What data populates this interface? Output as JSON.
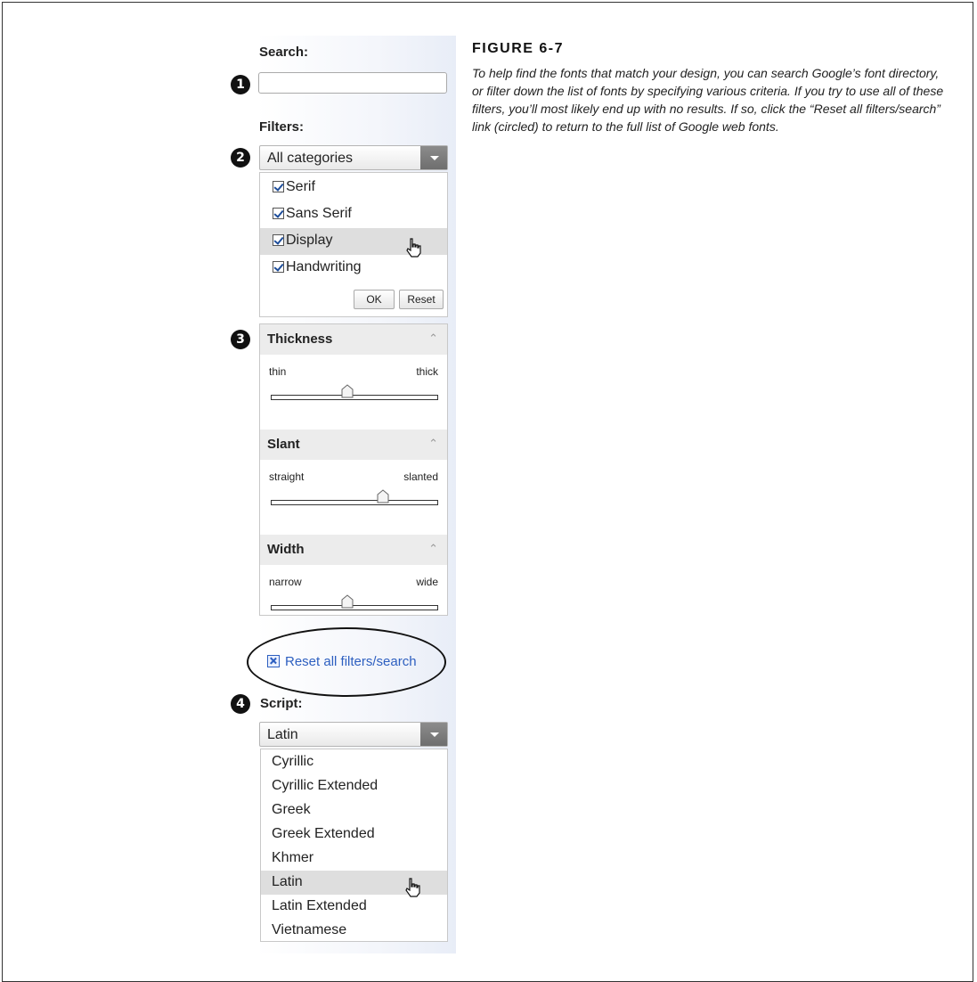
{
  "labels": {
    "search": "Search:",
    "filters": "Filters:",
    "script": "Script:"
  },
  "search": {
    "value": ""
  },
  "badges": [
    "1",
    "2",
    "3",
    "4"
  ],
  "category_select": {
    "selected": "All categories"
  },
  "categories": [
    {
      "label": "Serif",
      "checked": true
    },
    {
      "label": "Sans Serif",
      "checked": true
    },
    {
      "label": "Display",
      "checked": true,
      "hover": true
    },
    {
      "label": "Handwriting",
      "checked": true
    }
  ],
  "category_buttons": {
    "ok": "OK",
    "reset": "Reset"
  },
  "sliders": [
    {
      "title": "Thickness",
      "left": "thin",
      "right": "thick",
      "level": 0.45
    },
    {
      "title": "Slant",
      "left": "straight",
      "right": "slanted",
      "level": 0.68
    },
    {
      "title": "Width",
      "left": "narrow",
      "right": "wide",
      "level": 0.45
    }
  ],
  "reset_link": "Reset all filters/search",
  "script_select": {
    "selected": "Latin"
  },
  "script_options": [
    "Cyrillic",
    "Cyrillic Extended",
    "Greek",
    "Greek Extended",
    "Khmer",
    "Latin",
    "Latin Extended",
    "Vietnamese"
  ],
  "script_hover_index": 5,
  "figure": {
    "title": "FIGURE 6-7",
    "caption": "To help find the fonts that match your design, you can search Google’s font directory, or filter down the list of fonts by specifying various criteria. If you try to use all of these filters, you’ll most likely end up with no results. If so, click the “Reset all filters/search” link (circled) to return to the full list of Google web fonts."
  },
  "icons": [
    "chevron-down-icon",
    "checkbox-checked-icon",
    "collapse-icon",
    "slider-thumb-icon",
    "reset-x-icon",
    "hand-cursor-icon"
  ]
}
